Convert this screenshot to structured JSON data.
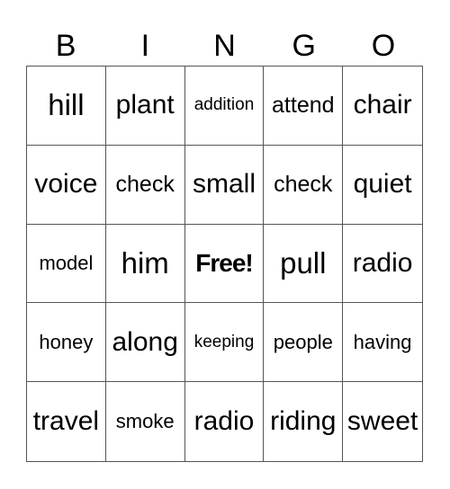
{
  "header": [
    "B",
    "I",
    "N",
    "G",
    "O"
  ],
  "cells": [
    {
      "word": "hill",
      "size": "xl"
    },
    {
      "word": "plant",
      "size": "l"
    },
    {
      "word": "addition",
      "size": "xs"
    },
    {
      "word": "attend",
      "size": "m"
    },
    {
      "word": "chair",
      "size": "l"
    },
    {
      "word": "voice",
      "size": "l"
    },
    {
      "word": "check",
      "size": "m"
    },
    {
      "word": "small",
      "size": "l"
    },
    {
      "word": "check",
      "size": "m"
    },
    {
      "word": "quiet",
      "size": "l"
    },
    {
      "word": "model",
      "size": "s"
    },
    {
      "word": "him",
      "size": "xl"
    },
    {
      "word": "Free!",
      "size": "free"
    },
    {
      "word": "pull",
      "size": "xl"
    },
    {
      "word": "radio",
      "size": "l"
    },
    {
      "word": "honey",
      "size": "s"
    },
    {
      "word": "along",
      "size": "l"
    },
    {
      "word": "keeping",
      "size": "xs"
    },
    {
      "word": "people",
      "size": "s"
    },
    {
      "word": "having",
      "size": "s"
    },
    {
      "word": "travel",
      "size": "l"
    },
    {
      "word": "smoke",
      "size": "s"
    },
    {
      "word": "radio",
      "size": "l"
    },
    {
      "word": "riding",
      "size": "l"
    },
    {
      "word": "sweet",
      "size": "l"
    }
  ]
}
